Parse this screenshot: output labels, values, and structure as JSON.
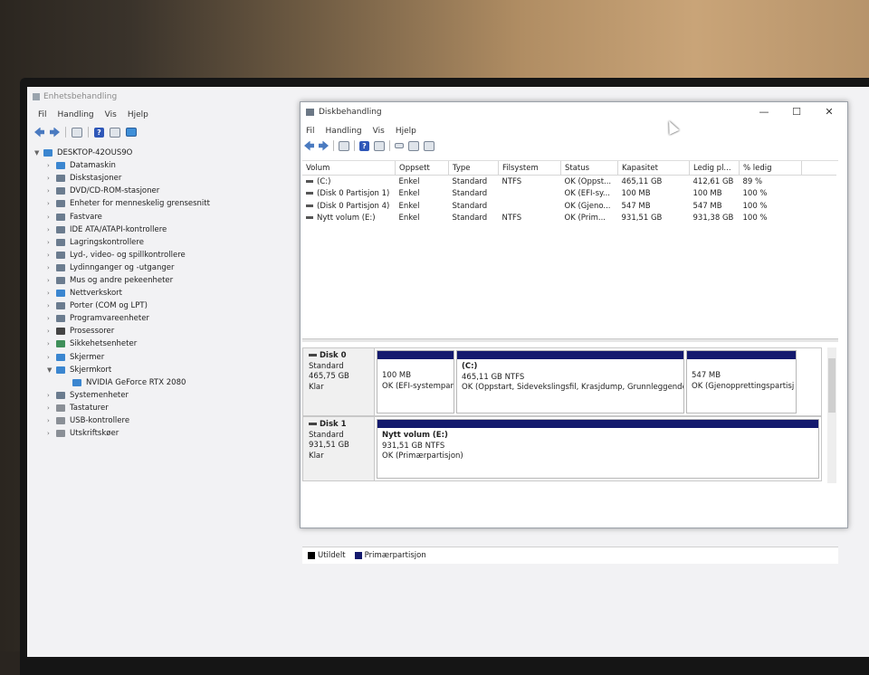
{
  "device_manager": {
    "title": "Enhetsbehandling",
    "menu": [
      "Fil",
      "Handling",
      "Vis",
      "Hjelp"
    ],
    "root": "DESKTOP-42OUS9O",
    "items": [
      {
        "label": "Datamaskin",
        "icon": "computer-icon",
        "expanded": false
      },
      {
        "label": "Diskstasjoner",
        "icon": "disk-drive-icon",
        "expanded": false
      },
      {
        "label": "DVD/CD-ROM-stasjoner",
        "icon": "dvd-icon",
        "expanded": false
      },
      {
        "label": "Enheter for menneskelig grensesnitt",
        "icon": "hid-icon",
        "expanded": false
      },
      {
        "label": "Fastvare",
        "icon": "firmware-icon",
        "expanded": false
      },
      {
        "label": "IDE ATA/ATAPI-kontrollere",
        "icon": "ide-icon",
        "expanded": false
      },
      {
        "label": "Lagringskontrollere",
        "icon": "storage-controller-icon",
        "expanded": false
      },
      {
        "label": "Lyd-, video- og spillkontrollere",
        "icon": "audio-icon",
        "expanded": false
      },
      {
        "label": "Lydinnganger og -utganger",
        "icon": "speaker-icon",
        "expanded": false
      },
      {
        "label": "Mus og andre pekeenheter",
        "icon": "mouse-icon",
        "expanded": false
      },
      {
        "label": "Nettverkskort",
        "icon": "network-icon",
        "expanded": false
      },
      {
        "label": "Porter (COM og LPT)",
        "icon": "port-icon",
        "expanded": false
      },
      {
        "label": "Programvareenheter",
        "icon": "software-device-icon",
        "expanded": false
      },
      {
        "label": "Prosessorer",
        "icon": "processor-icon",
        "expanded": false
      },
      {
        "label": "Sikkehetsenheter",
        "icon": "security-icon",
        "expanded": false
      },
      {
        "label": "Skjermer",
        "icon": "monitor-icon",
        "expanded": false
      },
      {
        "label": "Skjermkort",
        "icon": "display-adapter-icon",
        "expanded": true
      },
      {
        "label": "NVIDIA GeForce RTX 2080",
        "icon": "display-adapter-icon",
        "child": true
      },
      {
        "label": "Systemenheter",
        "icon": "system-icon",
        "expanded": false
      },
      {
        "label": "Tastaturer",
        "icon": "keyboard-icon",
        "expanded": false
      },
      {
        "label": "USB-kontrollere",
        "icon": "usb-icon",
        "expanded": false
      },
      {
        "label": "Utskriftskøer",
        "icon": "printer-icon",
        "expanded": false
      }
    ]
  },
  "disk_management": {
    "title": "Diskbehandling",
    "menu": [
      "Fil",
      "Handling",
      "Vis",
      "Hjelp"
    ],
    "columns": [
      "Volum",
      "Oppsett",
      "Type",
      "Filsystem",
      "Status",
      "Kapasitet",
      "Ledig pl...",
      "% ledig"
    ],
    "volumes": [
      [
        "(C:)",
        "Enkel",
        "Standard",
        "NTFS",
        "OK (Oppst...",
        "465,11 GB",
        "412,61 GB",
        "89 %"
      ],
      [
        "(Disk 0 Partisjon 1)",
        "Enkel",
        "Standard",
        "",
        "OK (EFI-sy...",
        "100 MB",
        "100 MB",
        "100 %"
      ],
      [
        "(Disk 0 Partisjon 4)",
        "Enkel",
        "Standard",
        "",
        "OK (Gjeno...",
        "547 MB",
        "547 MB",
        "100 %"
      ],
      [
        "Nytt volum (E:)",
        "Enkel",
        "Standard",
        "NTFS",
        "OK (Prim...",
        "931,51 GB",
        "931,38 GB",
        "100 %"
      ]
    ],
    "disk0": {
      "name": "Disk 0",
      "type": "Standard",
      "size": "465,75 GB",
      "state": "Klar",
      "p1": {
        "size": "100 MB",
        "status": "OK (EFI-systempar"
      },
      "p2": {
        "name": "(C:)",
        "size": "465,11 GB NTFS",
        "status": "OK (Oppstart, Sidevekslingsfil, Krasjdump, Grunnleggende"
      },
      "p3": {
        "size": "547 MB",
        "status": "OK (Gjenopprettingspartisj"
      }
    },
    "disk1": {
      "name": "Disk 1",
      "type": "Standard",
      "size": "931,51 GB",
      "state": "Klar",
      "p1": {
        "name": "Nytt volum  (E:)",
        "size": "931,51 GB NTFS",
        "status": "OK (Primærpartisjon)"
      }
    },
    "legend": {
      "unallocated": "Utildelt",
      "primary": "Primærpartisjon",
      "unallocated_color": "#000000",
      "primary_color": "#141a6e"
    }
  }
}
